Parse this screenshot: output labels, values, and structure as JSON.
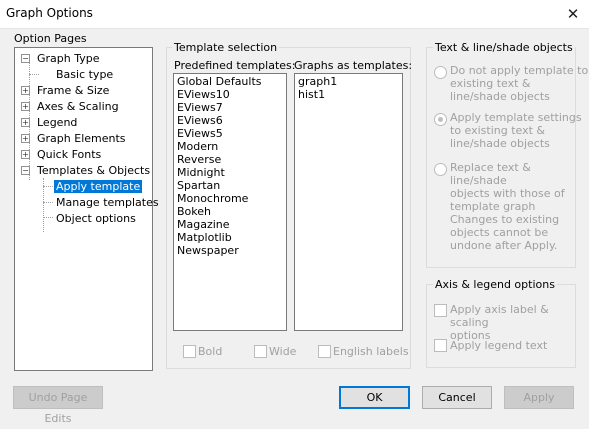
{
  "window": {
    "title": "Graph Options"
  },
  "option_pages": {
    "label": "Option Pages",
    "tree": [
      {
        "label": "Graph Type",
        "expander": "⊟"
      },
      {
        "label": "Basic type"
      },
      {
        "label": "Frame & Size",
        "expander": "⊞"
      },
      {
        "label": "Axes & Scaling",
        "expander": "⊞"
      },
      {
        "label": "Legend",
        "expander": "⊞"
      },
      {
        "label": "Graph Elements",
        "expander": "⊞"
      },
      {
        "label": "Quick Fonts",
        "expander": "⊞"
      },
      {
        "label": "Templates & Objects",
        "expander": "⊟"
      },
      {
        "label": "Apply template"
      },
      {
        "label": "Manage templates"
      },
      {
        "label": "Object options"
      }
    ]
  },
  "template_selection": {
    "label": "Template selection",
    "predefined_label": "Predefined templates:",
    "predefined": [
      "Global Defaults",
      "EViews10",
      "EViews7",
      "EViews6",
      "EViews5",
      "Modern",
      "Reverse",
      "Midnight",
      "Spartan",
      "Monochrome",
      "Bokeh",
      "Magazine",
      "Matplotlib",
      "Newspaper"
    ],
    "graphs_label": "Graphs as templates:",
    "graphs": [
      "graph1",
      "hist1"
    ],
    "options": {
      "bold": "Bold",
      "wide": "Wide",
      "english_labels": "English labels"
    }
  },
  "text_objects": {
    "label": "Text & line/shade objects",
    "radios": [
      {
        "lines": [
          "Do not apply template to",
          "existing text &",
          "line/shade objects"
        ]
      },
      {
        "lines": [
          "Apply template settings",
          "to existing text &",
          "line/shade objects"
        ]
      },
      {
        "lines": [
          "Replace text & line/shade",
          "objects with those of",
          "template graph"
        ]
      }
    ],
    "note": [
      "Changes to existing",
      "objects cannot be",
      "undone after Apply."
    ]
  },
  "axis_legend": {
    "label": "Axis & legend options",
    "axis_label": [
      "Apply axis label & scaling",
      "options"
    ],
    "legend_label": "Apply legend text"
  },
  "buttons": {
    "undo": "Undo Page Edits",
    "ok": "OK",
    "cancel": "Cancel",
    "apply": "Apply"
  }
}
